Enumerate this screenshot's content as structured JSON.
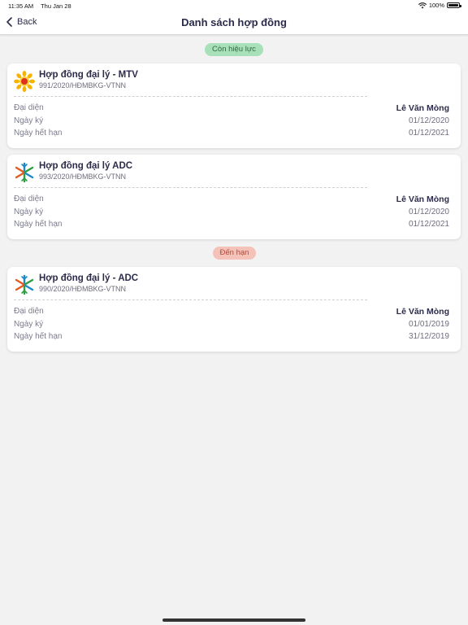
{
  "status_bar": {
    "time": "11:35 AM",
    "date": "Thu Jan 28",
    "battery": "100%"
  },
  "nav": {
    "back_label": "Back",
    "title": "Danh sách hợp đồng"
  },
  "sections": {
    "active_label": "Còn hiệu lực",
    "due_label": "Đến hạn"
  },
  "row_labels": {
    "representative": "Đại diện",
    "signed": "Ngày ký",
    "expires": "Ngày hết hạn"
  },
  "contracts": [
    {
      "title": "Hợp đồng đại lý - MTV",
      "code": "991/2020/HĐMBKG-VTNN",
      "representative": "Lê Văn Mòng",
      "signed_date": "01/12/2020",
      "expiry_date": "01/12/2021",
      "logo": "sunflower-logo"
    },
    {
      "title": "Hợp đồng đại lý ADC",
      "code": "993/2020/HĐMBKG-VTNN",
      "representative": "Lê Văn Mòng",
      "signed_date": "01/12/2020",
      "expiry_date": "01/12/2021",
      "logo": "asterisk-logo"
    },
    {
      "title": "Hợp đồng đại lý - ADC",
      "code": "990/2020/HĐMBKG-VTNN",
      "representative": "Lê Văn Mòng",
      "signed_date": "01/01/2019",
      "expiry_date": "31/12/2019",
      "logo": "asterisk-logo"
    }
  ],
  "colors": {
    "active_badge": "#a8e0b9",
    "due_badge": "#f4c2b8",
    "text_primary": "#2b2b4b"
  }
}
